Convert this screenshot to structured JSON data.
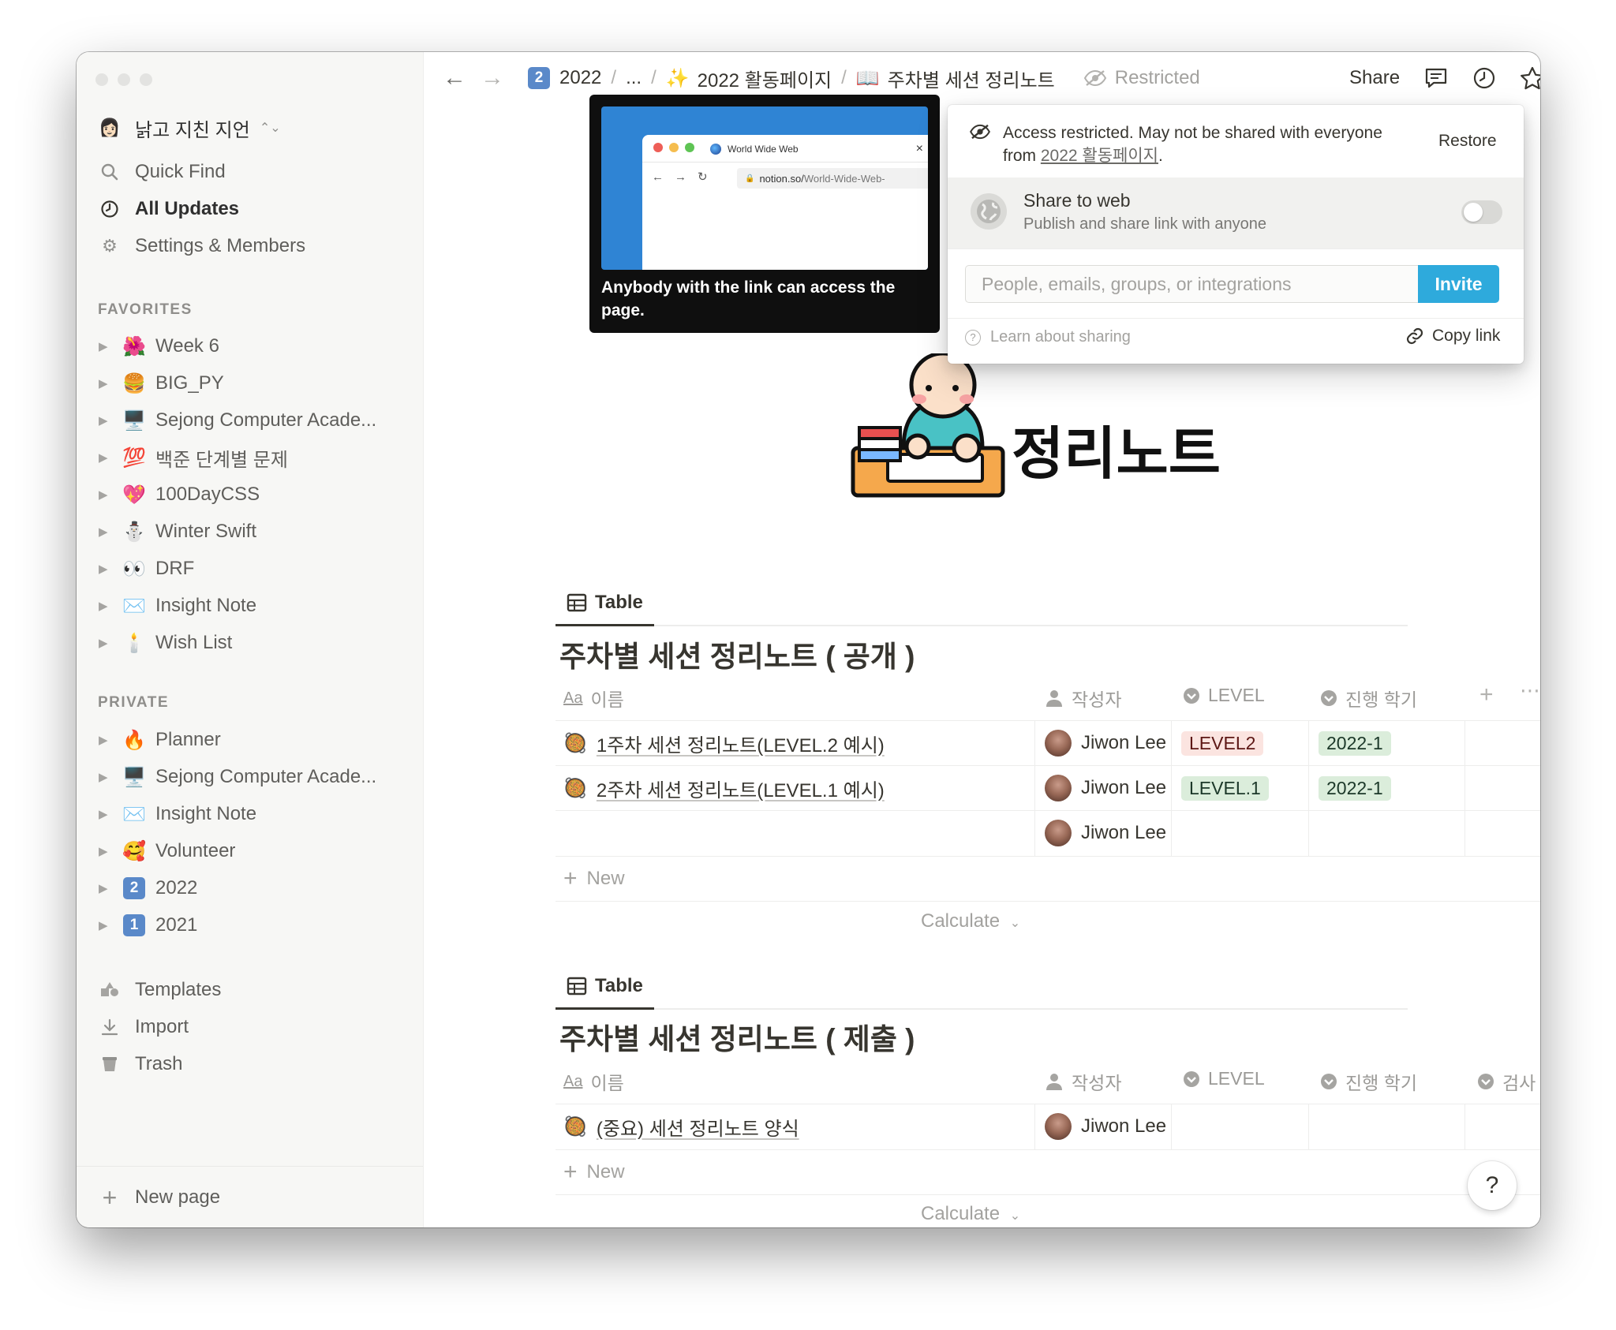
{
  "workspace": {
    "name": "낡고 지친 지언",
    "icon": "👩🏻"
  },
  "sidebar": {
    "top_items": [
      {
        "label": "Quick Find",
        "icon": "search-icon"
      },
      {
        "label": "All Updates",
        "icon": "clock-icon"
      },
      {
        "label": "Settings & Members",
        "icon": "gear-icon"
      }
    ],
    "favorites_header": "FAVORITES",
    "favorites": [
      {
        "emoji": "🌺",
        "label": "Week 6"
      },
      {
        "emoji": "🍔",
        "label": "BIG_PY"
      },
      {
        "emoji": "🖥️",
        "label": "Sejong Computer Acade..."
      },
      {
        "emoji": "💯",
        "label": "백준 단계별 문제"
      },
      {
        "emoji": "💖",
        "label": "100DayCSS"
      },
      {
        "emoji": "⛄",
        "label": "Winter Swift"
      },
      {
        "emoji": "👀",
        "label": "DRF"
      },
      {
        "emoji": "✉️",
        "label": "Insight Note"
      },
      {
        "emoji": "🕯️",
        "label": "Wish List"
      }
    ],
    "private_header": "PRIVATE",
    "private": [
      {
        "emoji": "🔥",
        "label": "Planner"
      },
      {
        "emoji": "🖥️",
        "label": "Sejong Computer Acade..."
      },
      {
        "emoji": "✉️",
        "label": "Insight Note"
      },
      {
        "emoji": "🥰",
        "label": "Volunteer"
      },
      {
        "emoji": "2",
        "label": "2022"
      },
      {
        "emoji": "1",
        "label": "2021"
      }
    ],
    "bottom_items": [
      {
        "label": "Templates",
        "icon": "templates-icon"
      },
      {
        "label": "Import",
        "icon": "import-icon"
      },
      {
        "label": "Trash",
        "icon": "trash-icon"
      }
    ],
    "new_page": "New page"
  },
  "topbar": {
    "crumb_2022": "2022",
    "crumb_ellipsis": "...",
    "crumb_activity": "2022 활동페이지",
    "crumb_activity_emoji": "✨",
    "crumb_current": "주차별 세션 정리노트",
    "crumb_current_emoji": "📖",
    "separator": "/",
    "restricted": "Restricted",
    "share": "Share"
  },
  "tooltip": {
    "tab_title": "World Wide Web",
    "url_prefix": "notion.so/",
    "url_rest": "World-Wide-Web-",
    "text": "Anybody with the link can access the page."
  },
  "share_panel": {
    "access_line1": "Access restricted. May not be shared with everyone",
    "access_from": "from ",
    "access_link": "2022 활동페이지",
    "access_dot": ".",
    "restore": "Restore",
    "share_web_title": "Share to web",
    "share_web_sub": "Publish and share link with anyone",
    "share_web_on": false,
    "invite_placeholder": "People, emails, groups, or integrations",
    "invite_button": "Invite",
    "learn": "Learn about sharing",
    "copy_link": "Copy link"
  },
  "page": {
    "title_visible": "정리노트"
  },
  "tables": [
    {
      "tab": "Table",
      "title": "주차별 세션 정리노트 ( 공개 )",
      "columns": [
        "이름",
        "작성자",
        "LEVEL",
        "진행 학기"
      ],
      "rows": [
        {
          "name": "1주차 세션 정리노트(LEVEL.2 예시)",
          "author": "Jiwon Lee",
          "level": "LEVEL2",
          "semester": "2022-1"
        },
        {
          "name": "2주차 세션 정리노트(LEVEL.1 예시)",
          "author": "Jiwon Lee",
          "level": "LEVEL.1",
          "semester": "2022-1"
        },
        {
          "name": "",
          "author": "Jiwon Lee",
          "level": "",
          "semester": ""
        }
      ],
      "new": "New",
      "calculate": "Calculate"
    },
    {
      "tab": "Table",
      "title": "주차별 세션 정리노트 ( 제출 )",
      "columns": [
        "이름",
        "작성자",
        "LEVEL",
        "진행 학기",
        "검사"
      ],
      "rows": [
        {
          "name": "(중요) 세션 정리노트 양식",
          "author": "Jiwon Lee"
        }
      ],
      "new": "New",
      "calculate": "Calculate"
    }
  ],
  "help": "?",
  "colors": {
    "accent": "#2eaadc",
    "sidebar_bg": "#f7f7f5",
    "text": "#37352f",
    "muted": "#9b9a97"
  }
}
